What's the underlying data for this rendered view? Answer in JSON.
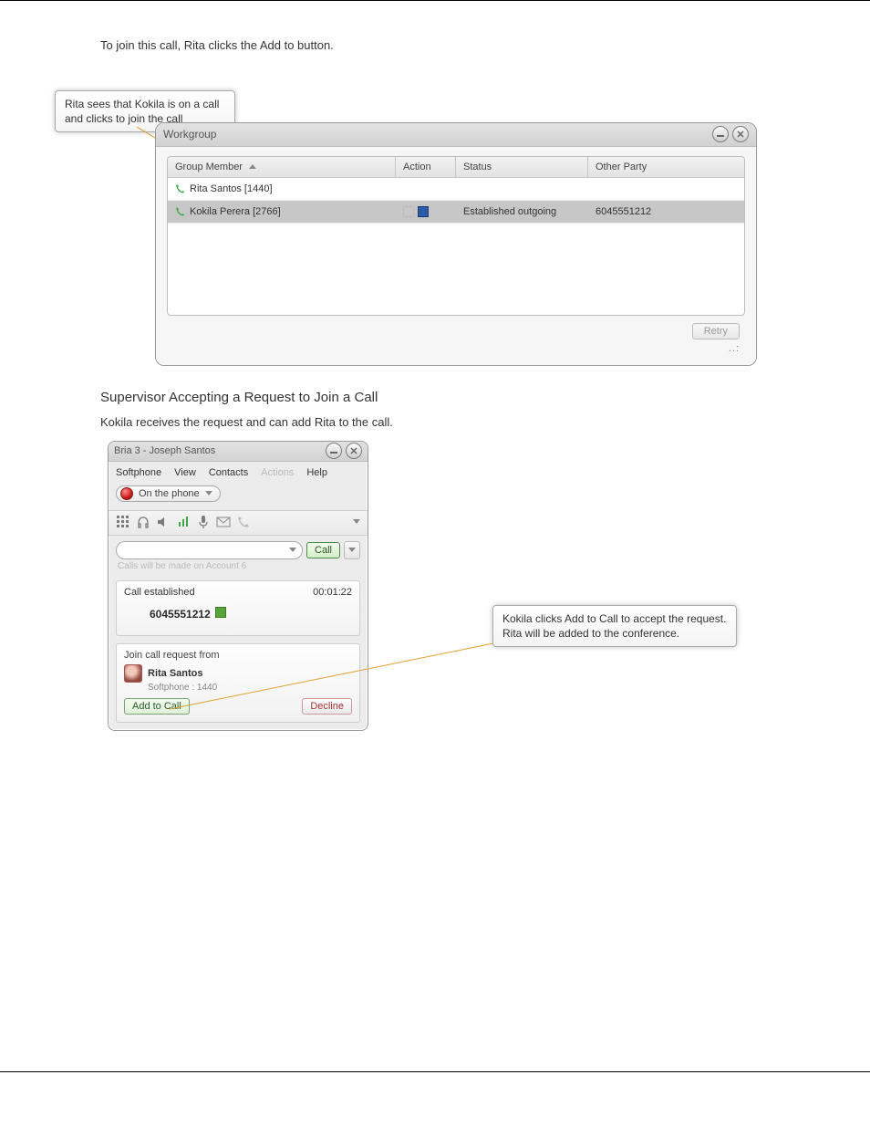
{
  "instruction": {
    "join_by_button": "To join this call, Rita clicks the Add to button.",
    "request_prompt": "Kokila receives the request and can add Rita to the call."
  },
  "heading_supervisor": "Supervisor Accepting a Request to Join a Call",
  "callout_join": "Rita sees that Kokila is on a call and clicks to join the call",
  "callout_accept": "Kokila clicks Add to Call to accept the request. Rita will be added to the conference.",
  "workgroup": {
    "title": "Workgroup",
    "columns": {
      "member": "Group Member",
      "action": "Action",
      "status": "Status",
      "party": "Other Party"
    },
    "rows": [
      {
        "member": "Rita Santos [1440]",
        "status": "",
        "party": ""
      },
      {
        "member": "Kokila Perera [2766]",
        "status": "Established outgoing",
        "party": "6045551212",
        "selected": true
      }
    ],
    "retry": "Retry"
  },
  "softphone": {
    "title": "Bria 3 - Joseph Santos",
    "menu": {
      "softphone": "Softphone",
      "view": "View",
      "contacts": "Contacts",
      "actions": "Actions",
      "help": "Help"
    },
    "presence": "On the phone",
    "call_button": "Call",
    "sub_note": "Calls will be made on Account 6",
    "call_established_label": "Call established",
    "timer": "00:01:22",
    "call_number": "6045551212",
    "join_label": "Join call request from",
    "join_name": "Rita Santos",
    "join_sub": "Softphone : 1440",
    "add_to_call": "Add to Call",
    "decline": "Decline"
  }
}
